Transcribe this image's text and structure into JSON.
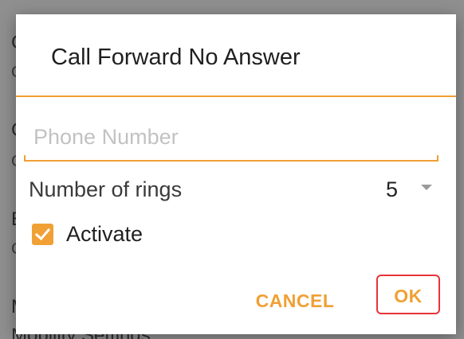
{
  "background": {
    "items_initials": [
      "C",
      "C",
      "E",
      "M"
    ],
    "items_sub_initials": [
      "C",
      "C",
      "C"
    ],
    "bottom_text": "Mobility Settings"
  },
  "dialog": {
    "title": "Call Forward No Answer",
    "phone_field": {
      "value": "",
      "placeholder": "Phone Number"
    },
    "rings": {
      "label": "Number of rings",
      "selected_value": "5"
    },
    "activate": {
      "label": "Activate",
      "checked": true
    },
    "buttons": {
      "cancel_label": "CANCEL",
      "ok_label": "OK"
    }
  },
  "colors": {
    "accent": "#f0a035",
    "highlight_border": "#e8333a",
    "scrim": "#8f8f8f"
  },
  "icons": {
    "checkbox": "checkmark-icon",
    "dropdown": "dropdown-arrow-icon"
  }
}
